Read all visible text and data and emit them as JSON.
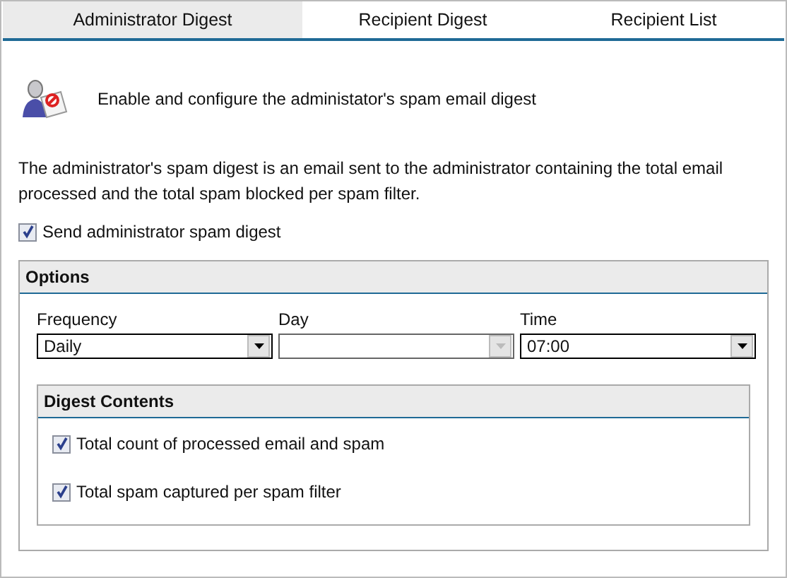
{
  "tabs": [
    {
      "label": "Administrator Digest",
      "selected": true
    },
    {
      "label": "Recipient Digest",
      "selected": false
    },
    {
      "label": "Recipient List",
      "selected": false
    }
  ],
  "header": {
    "text": "Enable and configure the administator's spam email digest"
  },
  "description": "The administrator's spam digest is an email sent to the administrator containing the total email processed and the total spam blocked per spam filter.",
  "send_digest": {
    "label": "Send administrator spam digest",
    "checked": true
  },
  "options": {
    "title": "Options",
    "fields": [
      {
        "label": "Frequency",
        "value": "Daily",
        "disabled": false
      },
      {
        "label": "Day",
        "disabled": true
      },
      {
        "label": "Time",
        "value": "07:00",
        "disabled": false
      }
    ],
    "digest_contents": {
      "title": "Digest Contents",
      "items": [
        {
          "label": "Total count of processed email and spam",
          "checked": true
        },
        {
          "label": "Total spam captured per spam filter",
          "checked": true
        }
      ]
    }
  }
}
